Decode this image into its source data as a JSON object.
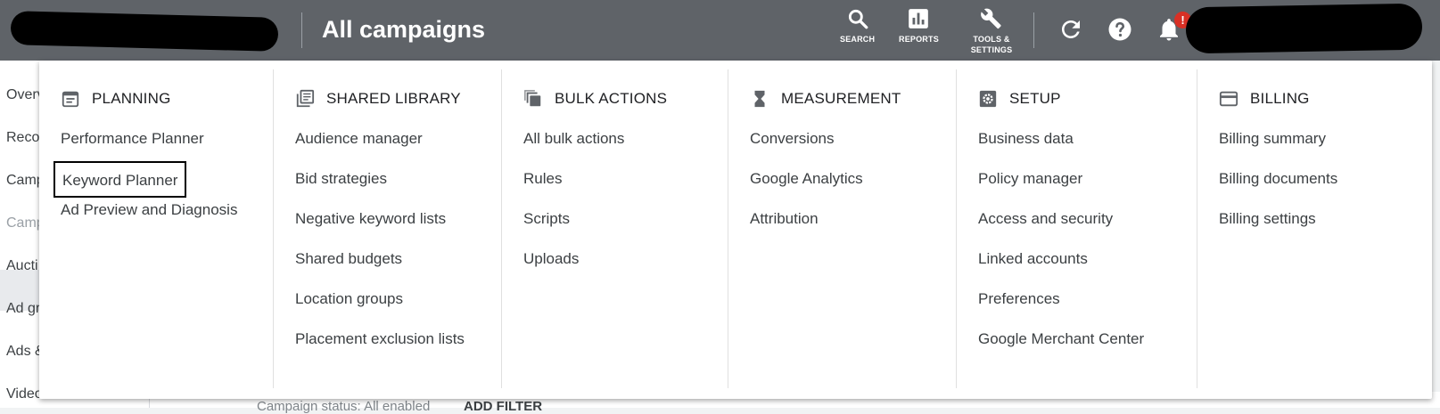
{
  "header": {
    "title": "All campaigns",
    "tools": [
      {
        "label": "SEARCH",
        "icon": "search-icon"
      },
      {
        "label": "REPORTS",
        "icon": "reports-icon"
      },
      {
        "label": "TOOLS & SETTINGS",
        "icon": "wrench-icon"
      }
    ],
    "notification_badge": "!"
  },
  "sidebar": {
    "items": [
      "Overv",
      "Reco",
      "Camp",
      "Camp",
      "Aucti",
      "Ad gr",
      "Ads &",
      "Videos"
    ]
  },
  "filter_bar": {
    "status": "Campaign status: All enabled",
    "add_filter": "ADD FILTER"
  },
  "menu": {
    "columns": [
      {
        "heading": "PLANNING",
        "icon": "calendar-icon",
        "items": [
          "Performance Planner",
          "Keyword Planner",
          "Ad Preview and Diagnosis"
        ]
      },
      {
        "heading": "SHARED LIBRARY",
        "icon": "library-icon",
        "items": [
          "Audience manager",
          "Bid strategies",
          "Negative keyword lists",
          "Shared budgets",
          "Location groups",
          "Placement exclusion lists"
        ]
      },
      {
        "heading": "BULK ACTIONS",
        "icon": "copy-icon",
        "items": [
          "All bulk actions",
          "Rules",
          "Scripts",
          "Uploads"
        ]
      },
      {
        "heading": "MEASUREMENT",
        "icon": "hourglass-icon",
        "items": [
          "Conversions",
          "Google Analytics",
          "Attribution"
        ]
      },
      {
        "heading": "SETUP",
        "icon": "gear-icon",
        "items": [
          "Business data",
          "Policy manager",
          "Access and security",
          "Linked accounts",
          "Preferences",
          "Google Merchant Center"
        ]
      },
      {
        "heading": "BILLING",
        "icon": "credit-card-icon",
        "items": [
          "Billing summary",
          "Billing documents",
          "Billing settings"
        ]
      }
    ]
  },
  "colors": {
    "topbar": "#5f6368",
    "badge": "#d93025",
    "icon": "#5f6368"
  }
}
